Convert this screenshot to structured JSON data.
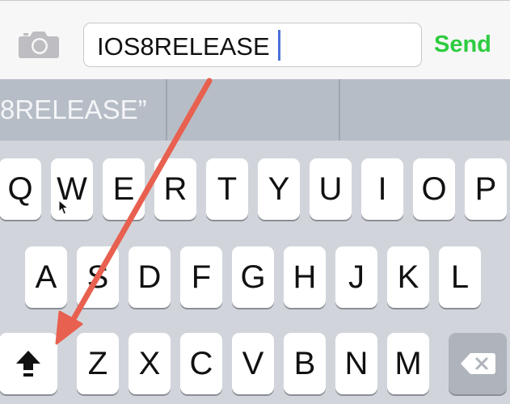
{
  "input_bar": {
    "text_value": "IOS8RELEASE",
    "send_label": "Send",
    "camera_icon": "camera-icon"
  },
  "suggestions": {
    "item_left": "8RELEASE”",
    "item_middle": "",
    "item_right": ""
  },
  "keyboard": {
    "row1": [
      "Q",
      "W",
      "E",
      "R",
      "T",
      "Y",
      "U",
      "I",
      "O",
      "P"
    ],
    "row2": [
      "A",
      "S",
      "D",
      "F",
      "G",
      "H",
      "J",
      "K",
      "L"
    ],
    "row3": [
      "Z",
      "X",
      "C",
      "V",
      "B",
      "N",
      "M"
    ],
    "shift_icon": "shift-icon",
    "delete_icon": "delete-icon"
  },
  "colors": {
    "send": "#2ecc40",
    "caret": "#4a72d9",
    "annotation_arrow": "#e8604f"
  }
}
